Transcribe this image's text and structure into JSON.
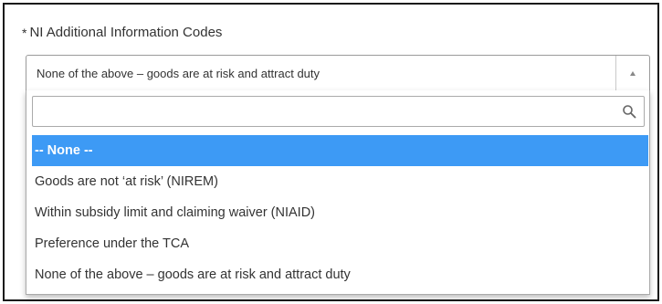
{
  "field": {
    "required_marker": "*",
    "label": "NI Additional Information Codes",
    "selected_value": "None of the above – goods are at risk and attract duty"
  },
  "search": {
    "value": "",
    "placeholder": ""
  },
  "options": [
    {
      "label": "-- None --",
      "highlighted": true
    },
    {
      "label": "Goods are not ‘at risk’ (NIREM)",
      "highlighted": false
    },
    {
      "label": "Within subsidy limit and claiming waiver (NIAID)",
      "highlighted": false
    },
    {
      "label": "Preference under the TCA",
      "highlighted": false
    },
    {
      "label": "None of the above – goods are at risk and attract duty",
      "highlighted": false
    }
  ],
  "icons": {
    "search": "search-icon",
    "toggle": "triangle-up-icon"
  },
  "colors": {
    "highlight": "#3d9af5",
    "text": "#333333",
    "border": "#aaaaaa"
  }
}
